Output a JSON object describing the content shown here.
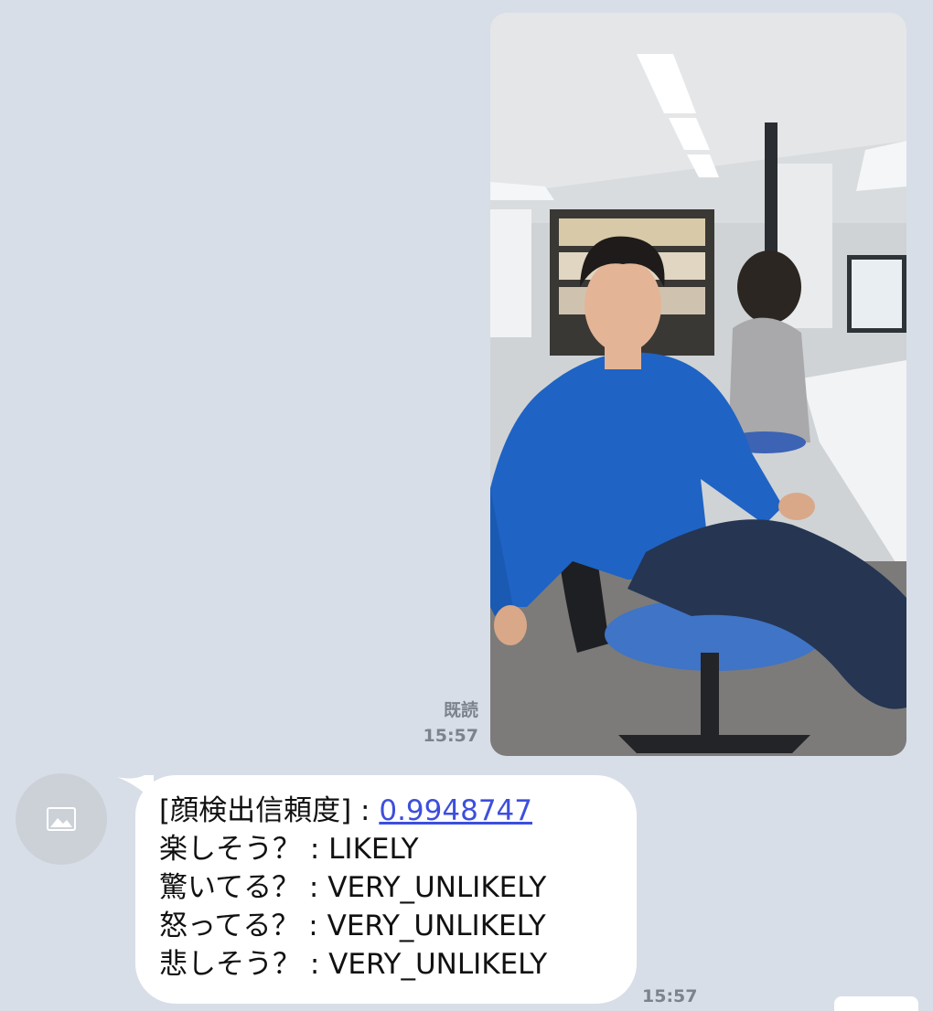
{
  "outgoing": {
    "read_receipt": "既読",
    "time": "15:57"
  },
  "incoming": {
    "lines": [
      {
        "label": "[顔検出信頼度] : ",
        "value": "0.9948747",
        "is_link": true
      },
      {
        "label": "楽しそう？ : ",
        "value": "LIKELY"
      },
      {
        "label": "驚いてる？ : ",
        "value": "VERY_UNLIKELY"
      },
      {
        "label": "怒ってる？ : ",
        "value": "VERY_UNLIKELY"
      },
      {
        "label": "悲しそう？ : ",
        "value": "VERY_UNLIKELY"
      }
    ],
    "time": "15:57",
    "avatar_icon": "image-placeholder-icon"
  },
  "colors": {
    "background": "#d8dee8",
    "bubble": "#ffffff",
    "link": "#3d4fdc",
    "meta": "#7b838d"
  }
}
